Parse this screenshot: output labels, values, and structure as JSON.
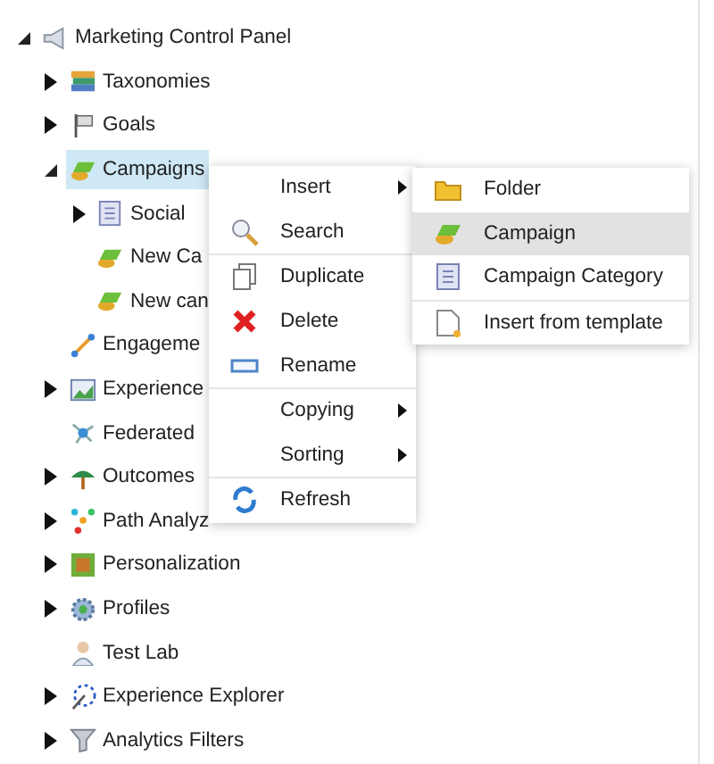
{
  "tree": [
    {
      "label": "Marketing Control Panel",
      "expandable": true,
      "expanded": true,
      "selected": false,
      "children": [
        {
          "label": "Taxonomies",
          "expandable": true,
          "expanded": false,
          "selected": false
        },
        {
          "label": "Goals",
          "expandable": true,
          "expanded": false,
          "selected": false
        },
        {
          "label": "Campaigns",
          "expandable": true,
          "expanded": true,
          "selected": true,
          "children": [
            {
              "label": "Social",
              "expandable": true,
              "expanded": false,
              "selected": false
            },
            {
              "label": "New Ca",
              "expandable": false,
              "selected": false
            },
            {
              "label": "New can",
              "expandable": false,
              "selected": false
            }
          ]
        },
        {
          "label": "Engageme",
          "expandable": false,
          "selected": false
        },
        {
          "label": "Experience",
          "expandable": true,
          "expanded": false,
          "selected": false
        },
        {
          "label": "Federated",
          "expandable": false,
          "selected": false
        },
        {
          "label": "Outcomes",
          "expandable": true,
          "expanded": false,
          "selected": false
        },
        {
          "label": "Path Analyz",
          "expandable": true,
          "expanded": false,
          "selected": false
        },
        {
          "label": "Personalization",
          "expandable": true,
          "expanded": false,
          "selected": false
        },
        {
          "label": "Profiles",
          "expandable": true,
          "expanded": false,
          "selected": false
        },
        {
          "label": "Test Lab",
          "expandable": false,
          "selected": false
        },
        {
          "label": "Experience Explorer",
          "expandable": true,
          "expanded": false,
          "selected": false
        },
        {
          "label": "Analytics Filters",
          "expandable": true,
          "expanded": false,
          "selected": false
        }
      ]
    }
  ],
  "context_menu": [
    {
      "label": "Insert",
      "submenu": true,
      "separator_before": false,
      "selected": false
    },
    {
      "label": "Search",
      "submenu": false,
      "separator_before": false,
      "selected": false
    },
    {
      "label": "Duplicate",
      "submenu": false,
      "separator_before": true,
      "selected": false
    },
    {
      "label": "Delete",
      "submenu": false,
      "separator_before": false,
      "selected": false
    },
    {
      "label": "Rename",
      "submenu": false,
      "separator_before": false,
      "selected": false
    },
    {
      "label": "Copying",
      "submenu": true,
      "separator_before": true,
      "selected": false
    },
    {
      "label": "Sorting",
      "submenu": true,
      "separator_before": false,
      "selected": false
    },
    {
      "label": "Refresh",
      "submenu": false,
      "separator_before": true,
      "selected": false
    }
  ],
  "insert_submenu": [
    {
      "label": "Folder",
      "separator_before": false,
      "selected": false
    },
    {
      "label": "Campaign",
      "separator_before": false,
      "selected": true
    },
    {
      "label": "Campaign Category",
      "separator_before": false,
      "selected": false
    },
    {
      "label": "Insert from template",
      "separator_before": true,
      "selected": false
    }
  ]
}
